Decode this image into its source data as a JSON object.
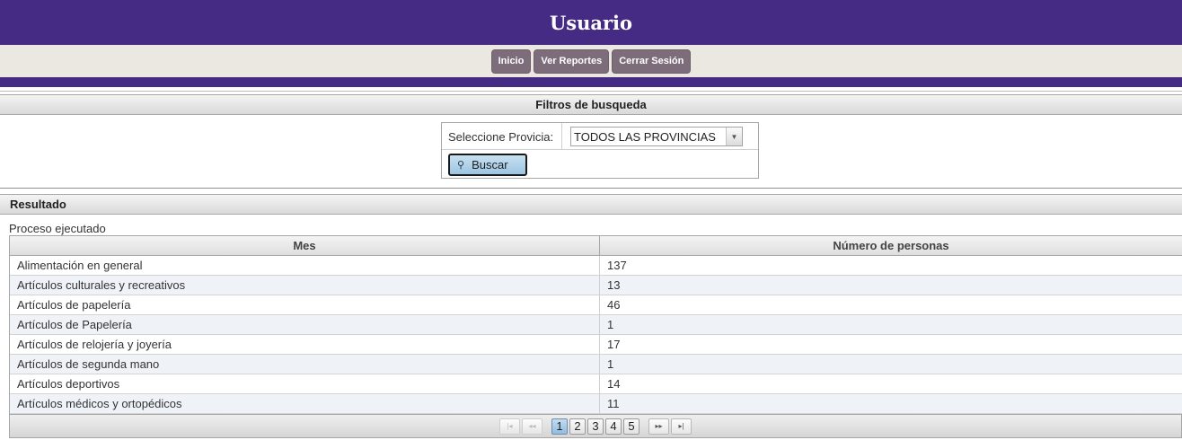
{
  "header": {
    "title": "Usuario"
  },
  "nav": {
    "items": [
      "Inicio",
      "Ver Reportes",
      "Cerrar Sesión"
    ]
  },
  "filters": {
    "section_title": "Filtros de busqueda",
    "province_label": "Seleccione Provicia:",
    "province_selected": "TODOS LAS PROVINCIAS",
    "search_button": "Buscar"
  },
  "result": {
    "section_title": "Resultado",
    "status_text": "Proceso ejecutado",
    "columns": [
      "Mes",
      "Número de personas"
    ],
    "rows": [
      {
        "mes": "Alimentación en general",
        "personas": "137"
      },
      {
        "mes": "Artículos culturales y recreativos",
        "personas": "13"
      },
      {
        "mes": "Artículos de papelería",
        "personas": "46"
      },
      {
        "mes": "Artículos de Papelería",
        "personas": "1"
      },
      {
        "mes": "Artículos de relojería y joyería",
        "personas": "17"
      },
      {
        "mes": "Artículos de segunda mano",
        "personas": "1"
      },
      {
        "mes": "Artículos deportivos",
        "personas": "14"
      },
      {
        "mes": "Artículos médicos y ortopédicos",
        "personas": "11"
      }
    ]
  },
  "pagination": {
    "pages": [
      "1",
      "2",
      "3",
      "4",
      "5"
    ],
    "current_page": "1",
    "first_icon": "first-page-icon",
    "prev_icon": "prev-page-icon",
    "next_icon": "next-page-icon",
    "last_icon": "last-page-icon"
  },
  "colors": {
    "header_bg": "#462b84",
    "nav_button_bg": "#7d6d7a",
    "nav_bar_bg": "#ebe7e1",
    "active_page": "#94bcdc"
  }
}
